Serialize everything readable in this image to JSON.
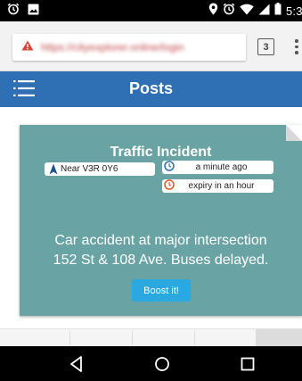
{
  "status_bar": {
    "time": "5:3",
    "icons": [
      "alarm-icon",
      "image-icon",
      "location-icon",
      "alarm-icon",
      "wifi-icon",
      "signal-icon",
      "battery-icon"
    ]
  },
  "browser": {
    "url": "https://cityexplorer.online/login",
    "tab_count": "3",
    "icons": [
      "insecure-warning-icon",
      "tab-switcher-icon",
      "overflow-menu-icon"
    ]
  },
  "header": {
    "title": "Posts",
    "menu_icon": "hamburger-icon"
  },
  "post": {
    "title": "Traffic Incident",
    "location": "Near V3R 0Y6",
    "posted": "a minute ago",
    "expiry": "expiry in an hour",
    "message_line1": "Car accident at major intersection",
    "message_line2": "152 St & 108 Ave. Buses delayed.",
    "boost_label": "Boost it!"
  },
  "nav_bar": {
    "icons": [
      "back-icon",
      "home-icon",
      "recents-icon"
    ]
  },
  "colors": {
    "header_blue": "#2f6fb4",
    "card_teal": "#6aa3a3",
    "boost_button": "#2aa8e0",
    "clock_icon": "#2f6fb4",
    "expiry_icon": "#e05a2b"
  }
}
